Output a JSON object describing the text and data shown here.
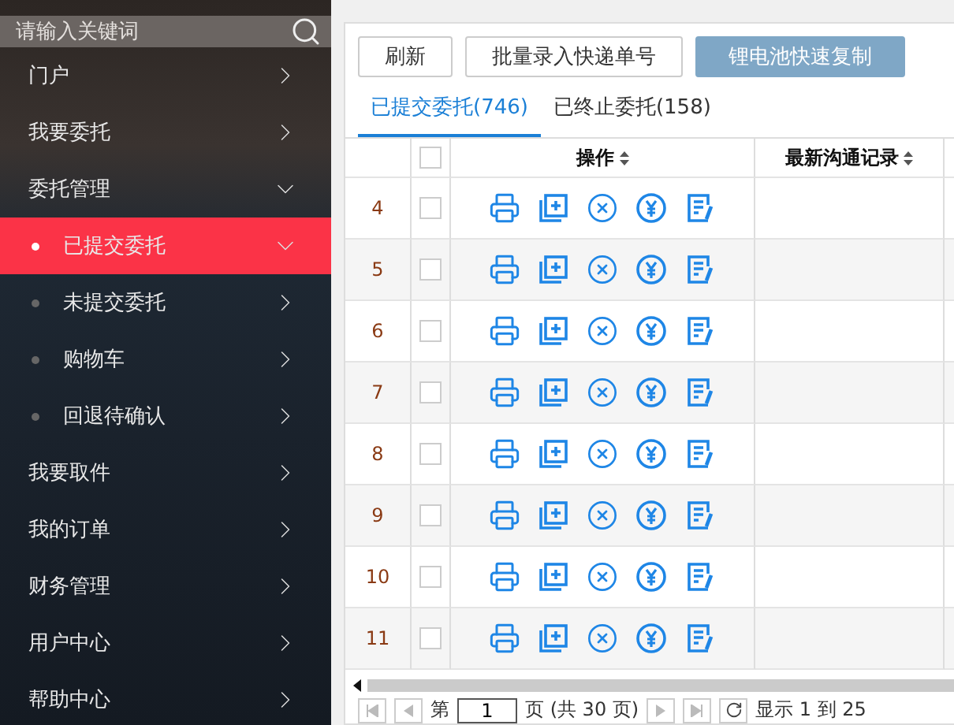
{
  "sidebar": {
    "search": {
      "placeholder": "请输入关键词"
    },
    "items": [
      {
        "label": "门户",
        "expanded": false
      },
      {
        "label": "我要委托",
        "expanded": false
      },
      {
        "label": "委托管理",
        "expanded": true,
        "children": [
          {
            "label": "已提交委托",
            "selected": true,
            "expanded": true
          },
          {
            "label": "未提交委托",
            "selected": false,
            "expanded": false
          },
          {
            "label": "购物车",
            "selected": false,
            "expanded": false
          },
          {
            "label": "回退待确认",
            "selected": false,
            "expanded": false
          }
        ]
      },
      {
        "label": "我要取件",
        "expanded": false
      },
      {
        "label": "我的订单",
        "expanded": false
      },
      {
        "label": "财务管理",
        "expanded": false
      },
      {
        "label": "用户中心",
        "expanded": false
      },
      {
        "label": "帮助中心",
        "expanded": false
      }
    ]
  },
  "toolbar": [
    {
      "label": "刷新",
      "kind": "plain"
    },
    {
      "label": "批量录入快递单号",
      "kind": "plain"
    },
    {
      "label": "锂电池快速复制",
      "kind": "primary"
    }
  ],
  "tabs": [
    {
      "label": "已提交委托(746)",
      "selected": true
    },
    {
      "label": "已终止委托(158)",
      "selected": false
    }
  ],
  "table": {
    "all_checked": false,
    "columns": [
      "操作",
      "最新沟通记录"
    ],
    "rows": [
      {
        "index": "4",
        "checked": false
      },
      {
        "index": "5",
        "checked": false
      },
      {
        "index": "6",
        "checked": false
      },
      {
        "index": "7",
        "checked": false
      },
      {
        "index": "8",
        "checked": false
      },
      {
        "index": "9",
        "checked": false
      },
      {
        "index": "10",
        "checked": false
      },
      {
        "index": "11",
        "checked": false
      }
    ]
  },
  "pager": {
    "before": "第",
    "page": "1",
    "after": "页 (共 30 页)",
    "info": "显示 1 到 25"
  }
}
